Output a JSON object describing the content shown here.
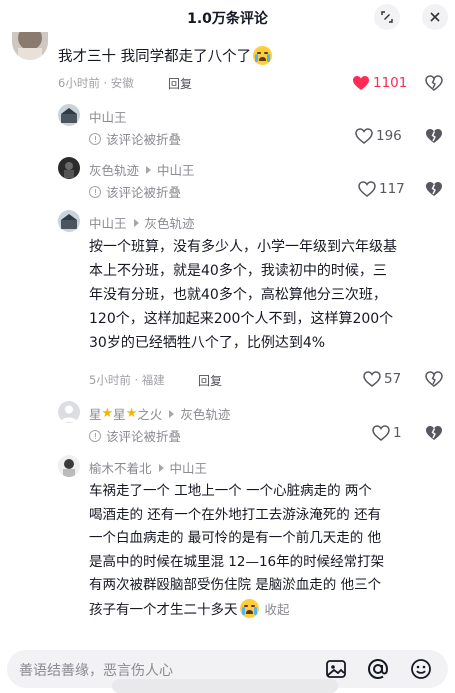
{
  "header": {
    "title": "1.0万条评论"
  },
  "comments": [
    {
      "name": "",
      "text": "我才三十  我同学都走了八个了",
      "time_loc": "6小时前 · 安徽",
      "reply_label": "回复",
      "likes": "1101",
      "liked": true
    }
  ],
  "replies": [
    {
      "name": "中山王",
      "folded_text": "该评论被折叠",
      "likes": "196"
    },
    {
      "name": "灰色轨迹",
      "reply_to": "中山王",
      "folded_text": "该评论被折叠",
      "likes": "117"
    },
    {
      "name": "中山王",
      "reply_to": "灰色轨迹",
      "lines": [
        "按一个班算，没有多少人，小学一年级到六年级基",
        "本上不分班，就是40多个，我读初中的时候，三",
        "年没有分班，也就40多个，高松算他分三次班，",
        "120个，这样加起来200个人不到，这样算200个",
        "30岁的已经牺牲八个了，比例达到4%"
      ],
      "time_loc": "5小时前 · 福建",
      "reply_label": "回复",
      "likes": "57"
    },
    {
      "name_parts": [
        "星",
        "星",
        "之火"
      ],
      "reply_to": "灰色轨迹",
      "folded_text": "该评论被折叠",
      "likes": "1"
    },
    {
      "name": "榆木不着北",
      "reply_to": "中山王",
      "lines": [
        "车祸走了一个  工地上一个  一个心脏病走的  两个",
        "喝酒走的  还有一个在外地打工去游泳淹死的 还有",
        "一个白血病走的  最可怜的是有一个前几天走的  他",
        "是高中的时候在城里混  12—16年的时候经常打架",
        "有两次被群殴脑部受伤住院 是脑淤血走的  他三个",
        "孩子有一个才生二十多天"
      ],
      "collapse_label": "收起"
    }
  ],
  "composer": {
    "placeholder": "善语结善缘，恶言伤人心"
  },
  "colors": {
    "like_red": "#fe2c55",
    "text": "#161823",
    "muted": "#8a8b91"
  },
  "icons": [
    "expand-icon",
    "close-icon",
    "heart-icon",
    "dislike-icon",
    "image-icon",
    "at-icon",
    "emoji-icon"
  ]
}
